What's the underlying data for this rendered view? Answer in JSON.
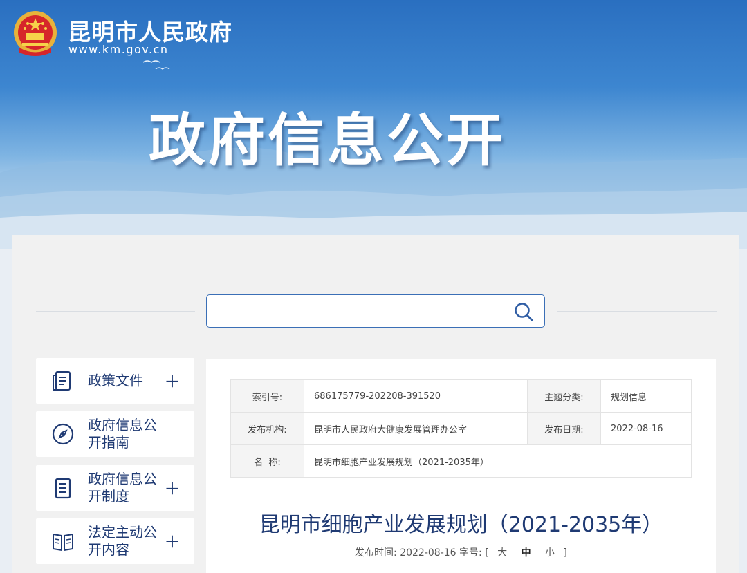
{
  "header": {
    "site_name": "昆明市人民政府",
    "site_url": "www.km.gov.cn",
    "headline": "政府信息公开"
  },
  "search": {
    "placeholder": "",
    "value": ""
  },
  "sidebar": {
    "items": [
      {
        "label": "政策文件",
        "icon": "document-icon",
        "expandable": true
      },
      {
        "label": "政府信息公开指南",
        "icon": "compass-icon",
        "expandable": false
      },
      {
        "label": "政府信息公开制度",
        "icon": "clipboard-icon",
        "expandable": true
      },
      {
        "label": "法定主动公开内容",
        "icon": "book-icon",
        "expandable": true
      }
    ]
  },
  "meta": {
    "index_label": "索引号:",
    "index_value": "686175779-202208-391520",
    "topic_label": "主题分类:",
    "topic_value": "规划信息",
    "publisher_label": "发布机构:",
    "publisher_value": "昆明市人民政府大健康发展管理办公室",
    "date_label": "发布日期:",
    "date_value": "2022-08-16",
    "name_label": "名  称:",
    "name_value": "昆明市细胞产业发展规划（2021-2035年）"
  },
  "document": {
    "title": "昆明市细胞产业发展规划（2021-2035年）",
    "publish_time_label": "发布时间:",
    "publish_time": "2022-08-16",
    "font_size_label": "字号:",
    "bracket_open": "[",
    "bracket_close": "]",
    "font_sizes": [
      "大",
      "中",
      "小"
    ]
  },
  "colors": {
    "accent": "#1f3a73",
    "search_border": "#3b6fb6",
    "banner_top": "#2a6fc0"
  }
}
